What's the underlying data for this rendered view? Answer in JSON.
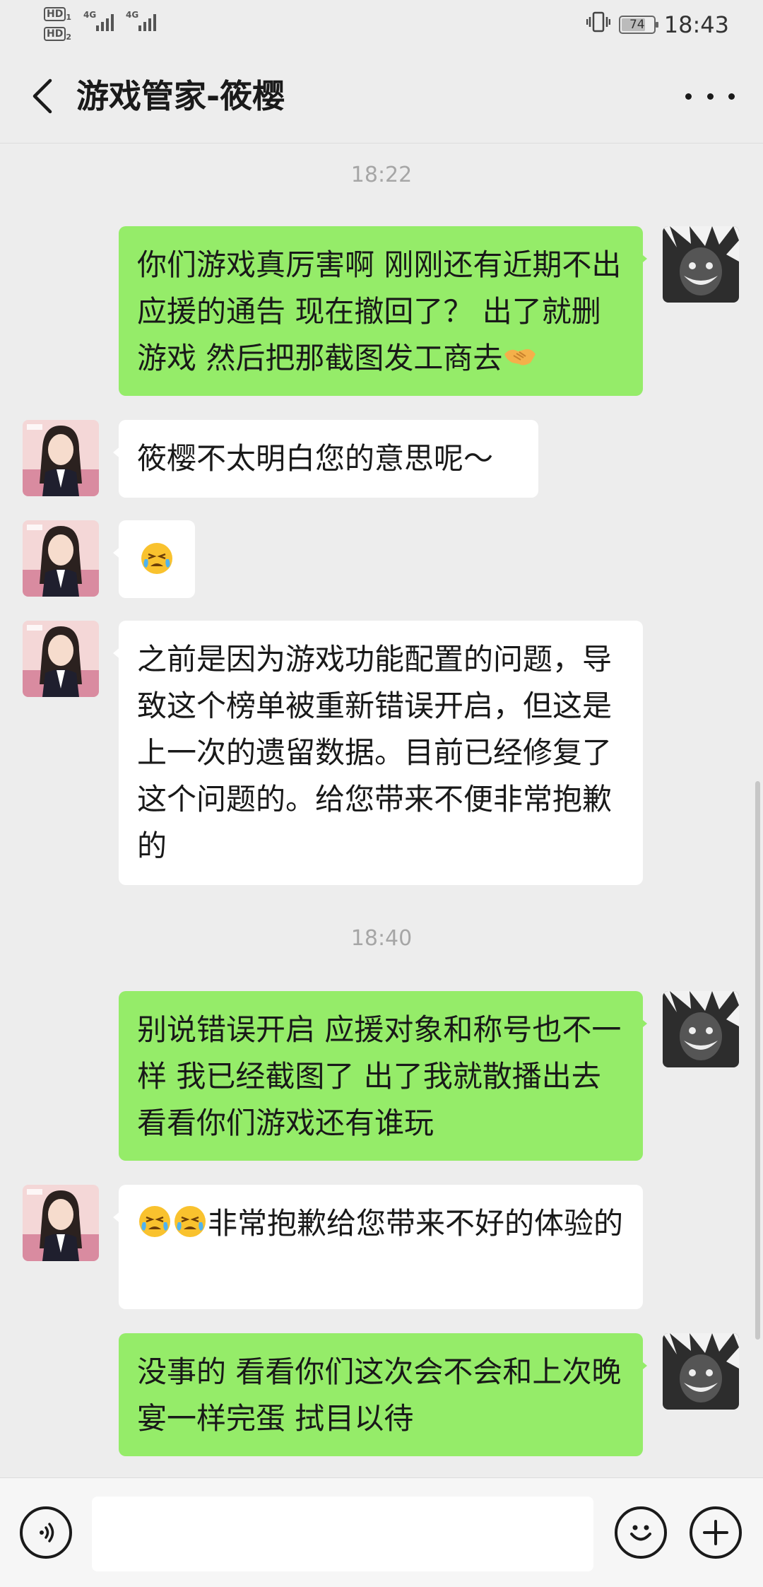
{
  "status_bar": {
    "hd1": "HD",
    "hd1_sub": "1",
    "hd2": "HD",
    "hd2_sub": "2",
    "signal1": "4G",
    "signal2": "4G",
    "battery": "74",
    "battery_level": 0.74,
    "time": "18:43"
  },
  "header": {
    "title": "游戏管家-筱樱"
  },
  "messages": [
    {
      "type": "timestamp",
      "text": "18:22"
    },
    {
      "type": "sent",
      "text": "你们游戏真厉害啊 刚刚还有近期不出应援的通告 现在撤回了？ 出了就删游戏 然后把那截图发工商去",
      "emoji": "handshake"
    },
    {
      "type": "received",
      "text": "筱樱不太明白您的意思呢～"
    },
    {
      "type": "received",
      "emoji": "crying-face"
    },
    {
      "type": "received",
      "text": "之前是因为游戏功能配置的问题，导致这个榜单被重新错误开启，但这是上一次的遗留数据。目前已经修复了这个问题的。给您带来不便非常抱歉的"
    },
    {
      "type": "timestamp",
      "text": "18:40"
    },
    {
      "type": "sent",
      "text": "别说错误开启 应援对象和称号也不一样 我已经截图了 出了我就散播出去 看看你们游戏还有谁玩"
    },
    {
      "type": "received",
      "emoji": "crying-face x2",
      "text": "非常抱歉给您带来不好的体验的"
    },
    {
      "type": "sent",
      "text": "没事的 看看你们这次会不会和上次晚宴一样完蛋 拭目以待"
    }
  ],
  "input_bar": {
    "voice_icon": "voice-icon",
    "emoji_icon": "smile-icon",
    "plus_icon": "plus-icon",
    "value": ""
  },
  "colors": {
    "background": "#ededed",
    "sent_bubble": "#95ec69",
    "received_bubble": "#ffffff",
    "timestamp": "#a6a6a6"
  }
}
